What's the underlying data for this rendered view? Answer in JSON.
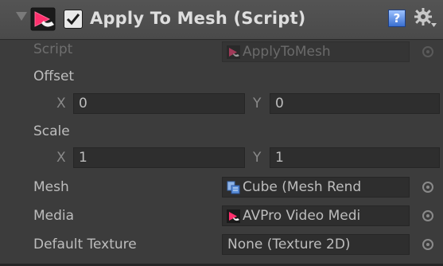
{
  "header": {
    "enabled": true,
    "title": "Apply To Mesh (Script)",
    "help_glyph": "?",
    "icons": [
      "fold-arrow-icon",
      "script-icon",
      "checkbox-icon",
      "help-icon",
      "gear-icon"
    ]
  },
  "script_row": {
    "label": "Script",
    "value": "ApplyToMesh"
  },
  "offset": {
    "label": "Offset",
    "x_label": "X",
    "x_value": "0",
    "y_label": "Y",
    "y_value": "0"
  },
  "scale": {
    "label": "Scale",
    "x_label": "X",
    "x_value": "1",
    "y_label": "Y",
    "y_value": "1"
  },
  "mesh_row": {
    "label": "Mesh",
    "value": "Cube (Mesh Rend"
  },
  "media_row": {
    "label": "Media",
    "value": "AVPro Video Medi"
  },
  "default_texture_row": {
    "label": "Default Texture",
    "value": "None (Texture 2D)"
  },
  "colors": {
    "background": "#3c3c3c",
    "header": "#4f4f4f",
    "field": "#2e2e2e",
    "text": "#bdbdbd",
    "accent_pink": "#e2336b",
    "help_blue": "#3a6fd0"
  }
}
